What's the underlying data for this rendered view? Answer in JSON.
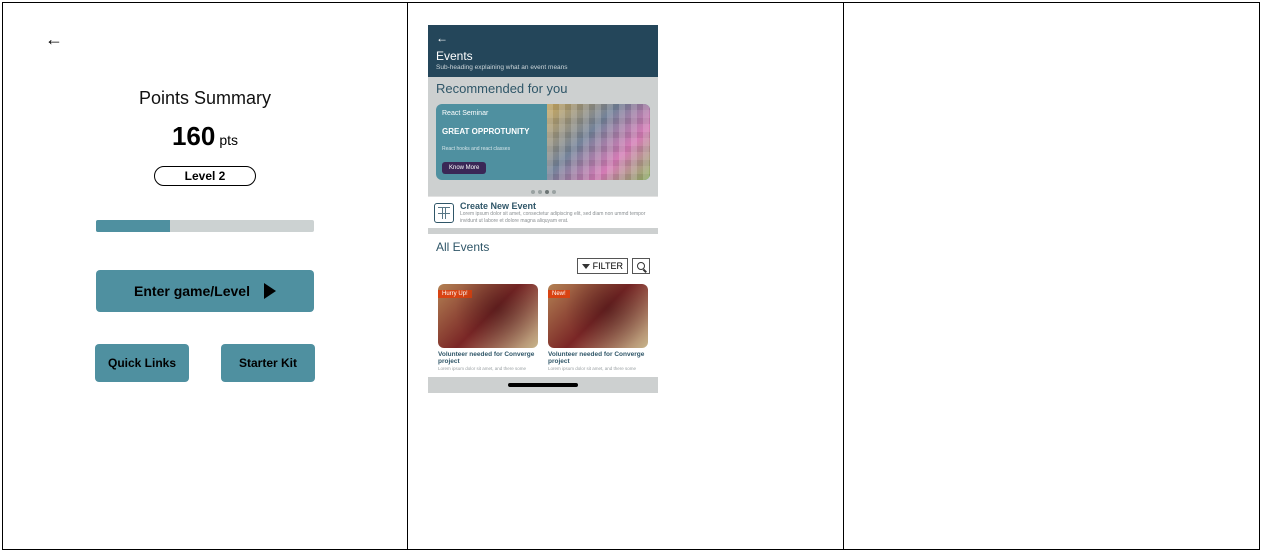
{
  "leftScreen": {
    "title": "Points Summary",
    "points_value": "160",
    "points_unit": "pts",
    "level_label": "Level 2",
    "progress_percent": 34,
    "enter_button": "Enter game/Level",
    "quick_links_btn": "Quick Links",
    "starter_kit_btn": "Starter Kit"
  },
  "eventsScreen": {
    "header_title": "Events",
    "header_sub": "Sub-heading explaining what an event means",
    "recommended_heading": "Recommended for you",
    "rec_card": {
      "name": "React Seminar",
      "tagline": "GREAT OPPROTUNITY",
      "sub": "React hooks and react classes",
      "cta": "Know More"
    },
    "create_event": {
      "title": "Create New Event",
      "desc": "Lorem ipsum dolor sit amet, consectetur adipiscing elit, sed diam non ummd tempor invidunt ut labore et dolore magna aliquyam erat."
    },
    "all_events_heading": "All Events",
    "filter_label": "FILTER",
    "event_cards": [
      {
        "badge": "Hurry Up!",
        "title": "Volunteer needed for Converge project",
        "desc": "Lorem ipsum dolor sit amet, and there some"
      },
      {
        "badge": "New!",
        "title": "Volunteer needed for Converge project",
        "desc": "Lorem ipsum dolor sit amet, and there some"
      }
    ]
  }
}
